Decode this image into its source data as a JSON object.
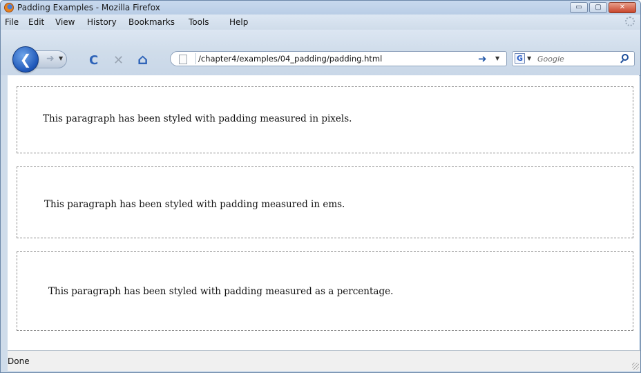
{
  "window": {
    "title": "Padding Examples - Mozilla Firefox",
    "buttons": {
      "minimize": "▭",
      "maximize": "▢",
      "close": "✕"
    }
  },
  "menubar": {
    "items": [
      "File",
      "Edit",
      "View",
      "History",
      "Bookmarks",
      "Tools",
      "Help"
    ]
  },
  "navbar": {
    "back_glyph": "❮",
    "forward_glyph": "➜",
    "reload_glyph": "C",
    "stop_glyph": "✕",
    "home_glyph": "⌂",
    "url": "/chapter4/examples/04_padding/padding.html",
    "go_glyph": "➜",
    "search_engine_glyph": "G",
    "search_placeholder": "Google"
  },
  "content": {
    "paragraphs": [
      "This paragraph has been styled with padding measured in pixels.",
      "This paragraph has been styled with padding measured in ems.",
      "This paragraph has been styled with padding measured as a percentage."
    ]
  },
  "statusbar": {
    "text": "Done"
  }
}
